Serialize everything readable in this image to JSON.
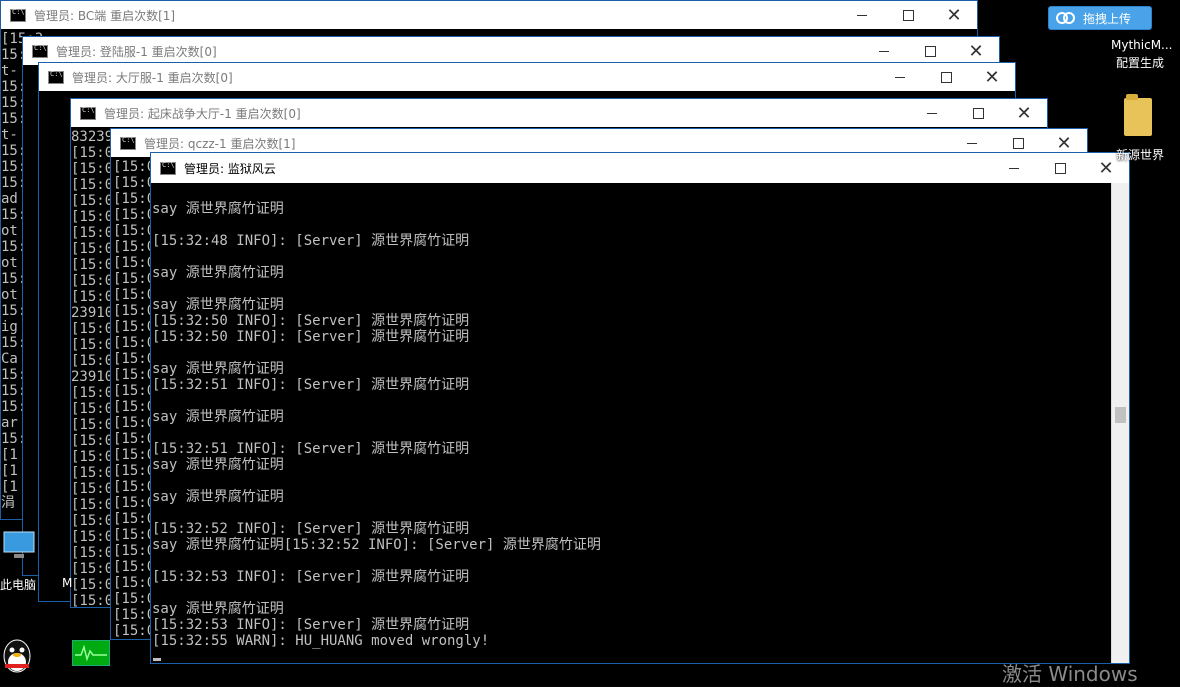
{
  "desktop": {
    "upload_button": "拖拽上传",
    "file_label_1": "MythicM...",
    "file_label_2": "配置生成",
    "folder_label": "新源世界",
    "pc_label": "此电脑",
    "pc_label_extra": "M",
    "watermark": "激活 Windows"
  },
  "windows": [
    {
      "title": "管理员: BC端 重启次数[1]",
      "lines": [
        "[15:3...",
        "15:",
        "t-",
        "15:",
        "15: f",
        "15:",
        "t-",
        "15:",
        "15:",
        "15:",
        "ad",
        "15:",
        "ot",
        "15:",
        "ot",
        "15:",
        "ot",
        "15:",
        "ig",
        "15:",
        "Ca",
        "15:",
        "15:",
        "15:",
        "ar",
        "15:",
        "[1",
        "[1",
        "[1",
        "涓"
      ]
    },
    {
      "title": "管理员: 登陆服-1 重启次数[0]",
      "lines": []
    },
    {
      "title": "管理员: 大厅服-1 重启次数[0]",
      "lines": []
    },
    {
      "title": "管理员: 起床战争大厅-1 重启次数[0]",
      "lines": [
        "83239",
        "[15:0",
        "[15:0",
        "[15:0",
        "[15:0",
        "[15:0",
        "[15:0",
        "[15:0",
        "[15:0",
        "[15:0",
        "[15:0",
        "23910",
        "[15:0",
        "[15:0",
        "[15:0",
        "23910",
        "[15:0",
        "[15:0",
        "[15:0",
        "[15:0",
        "[15:0",
        "[15:0",
        "[15:0",
        "[15:0",
        "[15:0",
        "[15:0",
        "[15:0",
        "[15:0",
        "[15:0",
        "[15:0"
      ]
    },
    {
      "title": "管理员: qczz-1 重启次数[1]",
      "lines": [
        "[15:0",
        "[15:0",
        "[15:0",
        "[15:0",
        "[15:0",
        "[15:0",
        "[15:0",
        "[15:0",
        "[15:0",
        "[15:0",
        "[15:0",
        "[15:0",
        "[15:0",
        "[15:0",
        "[15:0",
        "[15:0",
        "[15:0",
        "[15:0",
        "[15:0",
        "[15:0",
        "[15:0",
        "[15:0",
        "[15:0",
        "[15:0",
        "[15:0",
        "[15:0",
        "[15:0",
        "[15:0",
        "[15:0",
        "[15:0"
      ]
    },
    {
      "title": "管理员: 监狱风云",
      "lines": [
        "say 源世界腐竹证明",
        "",
        "[15:32:48 INFO]: [Server] 源世界腐竹证明",
        "",
        "say 源世界腐竹证明",
        "",
        "say 源世界腐竹证明",
        "[15:32:50 INFO]: [Server] 源世界腐竹证明",
        "[15:32:50 INFO]: [Server] 源世界腐竹证明",
        "",
        "say 源世界腐竹证明",
        "[15:32:51 INFO]: [Server] 源世界腐竹证明",
        "",
        "say 源世界腐竹证明",
        "",
        "[15:32:51 INFO]: [Server] 源世界腐竹证明",
        "say 源世界腐竹证明",
        "",
        "say 源世界腐竹证明",
        "",
        "[15:32:52 INFO]: [Server] 源世界腐竹证明",
        "say 源世界腐竹证明[15:32:52 INFO]: [Server] 源世界腐竹证明",
        "",
        "[15:32:53 INFO]: [Server] 源世界腐竹证明",
        "",
        "say 源世界腐竹证明",
        "[15:32:53 INFO]: [Server] 源世界腐竹证明",
        "[15:32:55 WARN]: HU_HUANG moved wrongly!"
      ]
    }
  ]
}
